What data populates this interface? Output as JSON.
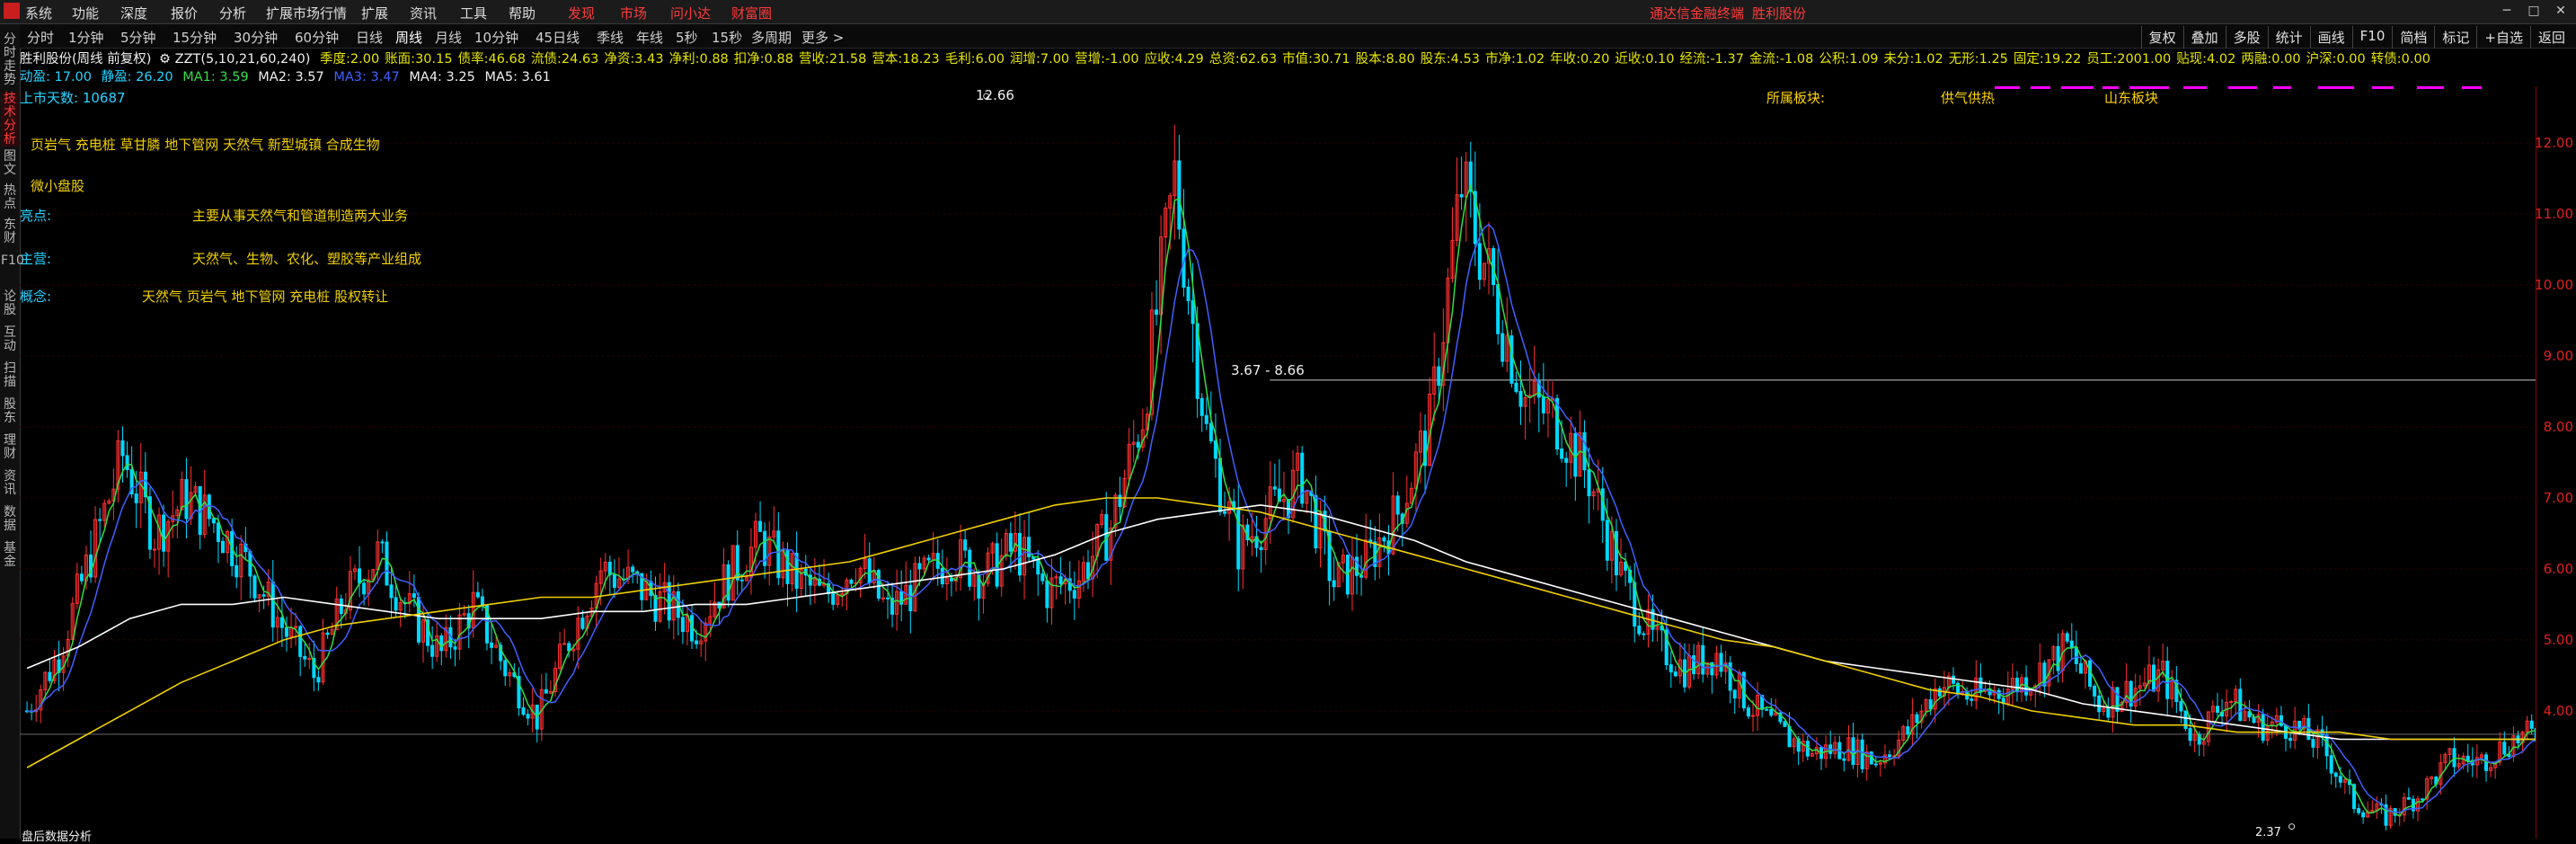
{
  "menu": {
    "items": [
      "系统",
      "功能",
      "深度",
      "报价",
      "分析",
      "扩展市场行情",
      "扩展",
      "资讯",
      "工具",
      "帮助",
      "发现",
      "市场",
      "问小达",
      "财富圈"
    ],
    "promo": [
      "通达信金融终端",
      "胜利股份"
    ]
  },
  "periods": {
    "items": [
      "分时",
      "1分钟",
      "5分钟",
      "15分钟",
      "30分钟",
      "60分钟",
      "日线",
      "周线",
      "月线",
      "10分钟",
      "45日线",
      "季线",
      "年线",
      "5秒",
      "15秒",
      "多周期",
      "更多 >"
    ],
    "active": "周线"
  },
  "right_tools": [
    "复权",
    "叠加",
    "多股",
    "统计",
    "画线",
    "F10",
    "简档",
    "标记",
    "+自选",
    "返回"
  ],
  "left_nav": [
    "分时走势",
    "技术分析",
    "图文",
    "热点",
    "东财",
    "F10",
    "论股",
    "互动",
    "扫描",
    "股东",
    "理财",
    "资讯",
    "数据",
    "基金"
  ],
  "stock_line": {
    "name": "胜利股份(周线 前复权)",
    "indicator": "ZZT(5,10,21,60,240)",
    "fields": [
      {
        "k": "季度:",
        "v": "2.00"
      },
      {
        "k": "账面:",
        "v": "30.15"
      },
      {
        "k": "债率:",
        "v": "46.68"
      },
      {
        "k": "流债:",
        "v": "24.63"
      },
      {
        "k": "净资:",
        "v": "3.43"
      },
      {
        "k": "净利:",
        "v": "0.88"
      },
      {
        "k": "扣净:",
        "v": "0.88"
      },
      {
        "k": "营收:",
        "v": "21.58"
      },
      {
        "k": "营本:",
        "v": "18.23"
      },
      {
        "k": "毛利:",
        "v": "6.00"
      },
      {
        "k": "润增:",
        "v": "7.00"
      },
      {
        "k": "营增:",
        "v": "-1.00"
      },
      {
        "k": "应收:",
        "v": "4.29"
      },
      {
        "k": "总资:",
        "v": "62.63"
      },
      {
        "k": "市值:",
        "v": "30.71"
      },
      {
        "k": "股本:",
        "v": "8.80"
      },
      {
        "k": "股东:",
        "v": "4.53"
      },
      {
        "k": "市净:",
        "v": "1.02"
      },
      {
        "k": "年收:",
        "v": "0.20"
      },
      {
        "k": "近收:",
        "v": "0.10"
      },
      {
        "k": "经流:",
        "v": "-1.37"
      },
      {
        "k": "金流:",
        "v": "-1.08"
      },
      {
        "k": "公积:",
        "v": "1.09"
      },
      {
        "k": "未分:",
        "v": "1.02"
      },
      {
        "k": "无形:",
        "v": "1.25"
      },
      {
        "k": "固定:",
        "v": "19.22"
      },
      {
        "k": "员工:",
        "v": "2001.00"
      },
      {
        "k": "贴现:",
        "v": "4.02"
      },
      {
        "k": "两融:",
        "v": "0.00"
      },
      {
        "k": "沪深:",
        "v": "0.00"
      },
      {
        "k": "转债:",
        "v": "0.00"
      }
    ]
  },
  "ma_line": {
    "dyn": "动盈: 17.00",
    "static": "静盈: 26.20",
    "ma1": "MA1: 3.59",
    "ma2": "MA2: 3.57",
    "ma3": "MA3: 3.47",
    "ma4": "MA4: 3.25",
    "ma5": "MA5: 3.61"
  },
  "overlay": {
    "listed_days": "上市天数: 10687",
    "concepts_top": "页岩气 充电桩 草甘膦 地下管网 天然气 新型城镇 合成生物",
    "tag": "微小盘股",
    "highlight_k": "亮点:",
    "highlight_v": "主要从事天然气和管道制造两大业务",
    "main_k": "主营:",
    "main_v": "天然气、生物、农化、塑胶等产业组成",
    "concept_k": "概念:",
    "concept_v": "天然气  页岩气  地下管网  充电桩  股权转让"
  },
  "sectors": [
    "所属板块:",
    "供气供热",
    "山东板块"
  ],
  "annotations": {
    "high": "12.66",
    "low": "2.37",
    "range": "3.67 - 8.66",
    "bottom_text": "盘后数据分析"
  },
  "y_ticks": [
    "12.00",
    "11.00",
    "10.00",
    "9.00",
    "8.00",
    "7.00",
    "6.00",
    "5.00",
    "4.00"
  ],
  "colors": {
    "ma1": "#ffffff",
    "ma2": "#f0d000",
    "ma3": "#ff44ff",
    "ma4": "#33dd44",
    "ma5": "#4060ff",
    "up": "#ff3030",
    "down": "#00d8ff",
    "axis": "#e02020"
  },
  "chart_data": {
    "type": "line",
    "title": "胜利股份(周线 前复权)",
    "ylim": [
      2.2,
      12.8
    ],
    "series": [
      {
        "name": "close",
        "values": [
          4.0,
          4.8,
          6.2,
          7.6,
          6.5,
          7.0,
          6.6,
          6.0,
          5.2,
          4.5,
          5.6,
          6.2,
          5.4,
          4.8,
          5.5,
          4.6,
          3.9,
          5.0,
          6.0,
          5.8,
          5.5,
          5.2,
          5.9,
          6.4,
          5.9,
          5.6,
          6.1,
          5.4,
          5.8,
          6.2,
          5.9,
          6.3,
          5.7,
          5.9,
          6.6,
          8.2,
          11.5,
          7.9,
          6.3,
          6.8,
          7.3,
          5.8,
          6.1,
          6.8,
          8.0,
          11.4,
          9.9,
          8.4,
          8.1,
          7.3,
          5.9,
          5.0,
          4.6,
          4.8,
          4.1,
          3.7,
          3.4,
          3.5,
          3.3,
          3.7,
          4.4,
          4.2,
          4.3,
          4.5,
          4.9,
          4.1,
          4.3,
          4.5,
          3.6,
          4.2,
          3.8,
          3.8,
          3.5,
          2.7,
          2.5,
          2.8,
          3.3,
          3.3,
          3.6,
          3.7
        ]
      },
      {
        "name": "MA1",
        "values": [
          4.6,
          4.9,
          5.3,
          5.5,
          5.5,
          5.6,
          5.5,
          5.4,
          5.3,
          5.3,
          5.3,
          5.4,
          5.4,
          5.5,
          5.5,
          5.6,
          5.7,
          5.8,
          5.9,
          6.0,
          6.2,
          6.5,
          6.7,
          6.8,
          6.9,
          6.8,
          6.6,
          6.4,
          6.1,
          5.9,
          5.7,
          5.5,
          5.3,
          5.1,
          4.9,
          4.7,
          4.6,
          4.5,
          4.4,
          4.3,
          4.1,
          4.0,
          3.9,
          3.8,
          3.7,
          3.6,
          3.6,
          3.6,
          3.6,
          3.6
        ]
      },
      {
        "name": "MA2",
        "values": [
          3.2,
          3.6,
          4.0,
          4.4,
          4.7,
          5.0,
          5.2,
          5.3,
          5.4,
          5.5,
          5.6,
          5.6,
          5.7,
          5.8,
          5.9,
          6.0,
          6.1,
          6.3,
          6.5,
          6.7,
          6.9,
          7.0,
          7.0,
          6.9,
          6.8,
          6.6,
          6.4,
          6.2,
          6.0,
          5.8,
          5.6,
          5.4,
          5.2,
          5.0,
          4.9,
          4.7,
          4.5,
          4.3,
          4.2,
          4.0,
          3.9,
          3.8,
          3.8,
          3.7,
          3.7,
          3.7,
          3.6,
          3.6,
          3.6,
          3.6
        ]
      }
    ]
  }
}
